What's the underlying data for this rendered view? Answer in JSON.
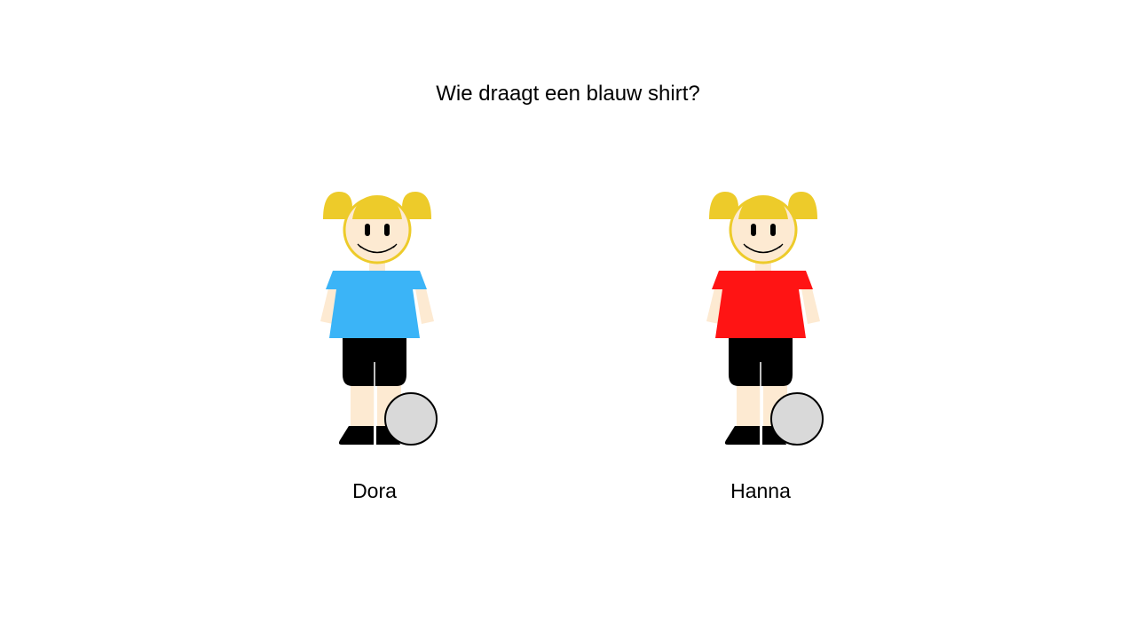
{
  "question": "Wie draagt een blauw shirt?",
  "colors": {
    "hair": "#EDCB2A",
    "skin": "#FDEAD2",
    "shorts": "#000000",
    "ball": "#D9D9D9",
    "shirt_blue": "#3BB4F7",
    "shirt_red": "#FF1414"
  },
  "characters": [
    {
      "name": "Dora",
      "shirt_color": "#3BB4F7",
      "shirt_color_name": "blauw"
    },
    {
      "name": "Hanna",
      "shirt_color": "#FF1414",
      "shirt_color_name": "rood"
    }
  ]
}
